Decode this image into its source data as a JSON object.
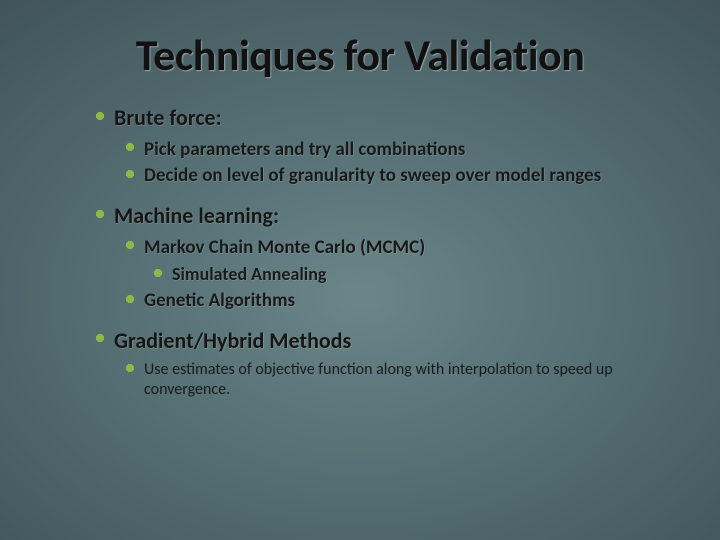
{
  "title": "Techniques for Validation",
  "content": {
    "s1": {
      "heading": "Brute force:",
      "items": {
        "a": "Pick parameters and try all combinations",
        "b": "Decide on level of granularity to sweep over model ranges"
      }
    },
    "s2": {
      "heading": "Machine learning:",
      "items": {
        "a": "Markov Chain Monte Carlo (MCMC)",
        "a_sub": {
          "i": "Simulated Annealing"
        },
        "b": "Genetic Algorithms"
      }
    },
    "s3": {
      "heading": "Gradient/Hybrid Methods",
      "items": {
        "a": "Use estimates of objective function along with interpolation to speed up convergence."
      }
    }
  }
}
